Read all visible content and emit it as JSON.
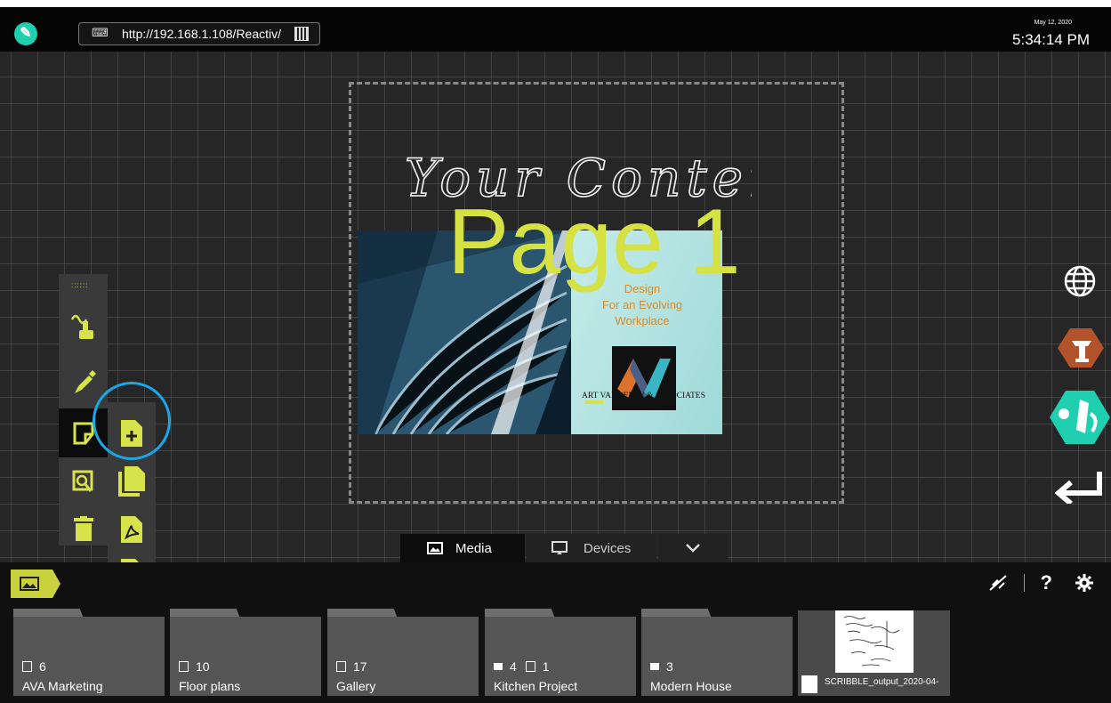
{
  "topbar": {
    "url": "http://192.168.1.108/Reactiv/",
    "date": "May 12, 2020",
    "time": "5:34:14 PM"
  },
  "canvas": {
    "handwriting": "Your Content",
    "page_label": "Page 1",
    "slide": {
      "line1": "Design",
      "line2": "For an Evolving",
      "line3": "Workplace",
      "firm": "ART VANDELAY & ASSOCIATES"
    }
  },
  "tools": {
    "grip": "::::::",
    "items": [
      "gesture-icon",
      "pen-icon",
      "page-icon",
      "zoom-icon",
      "trash-icon"
    ],
    "sub_items": [
      "new-page-icon",
      "copy-page-icon",
      "pdf-icon",
      "delete-page-icon"
    ]
  },
  "media_tabs": {
    "media": "Media",
    "devices": "Devices"
  },
  "tray": {
    "folders": [
      {
        "count": "6",
        "name": "AVA Marketing"
      },
      {
        "count": "10",
        "name": "Floor plans"
      },
      {
        "count": "17",
        "name": "Gallery"
      },
      {
        "count_a": "4",
        "count_b": "1",
        "name": "Kitchen Project"
      },
      {
        "count": "3",
        "name": "Modern House"
      }
    ],
    "document": {
      "name": "SCRIBBLE_output_2020-04-"
    },
    "help": "?"
  },
  "colors": {
    "accent": "#d7e34a",
    "highlight_circle": "#1aa7e8",
    "teal": "#1fcfb0"
  }
}
